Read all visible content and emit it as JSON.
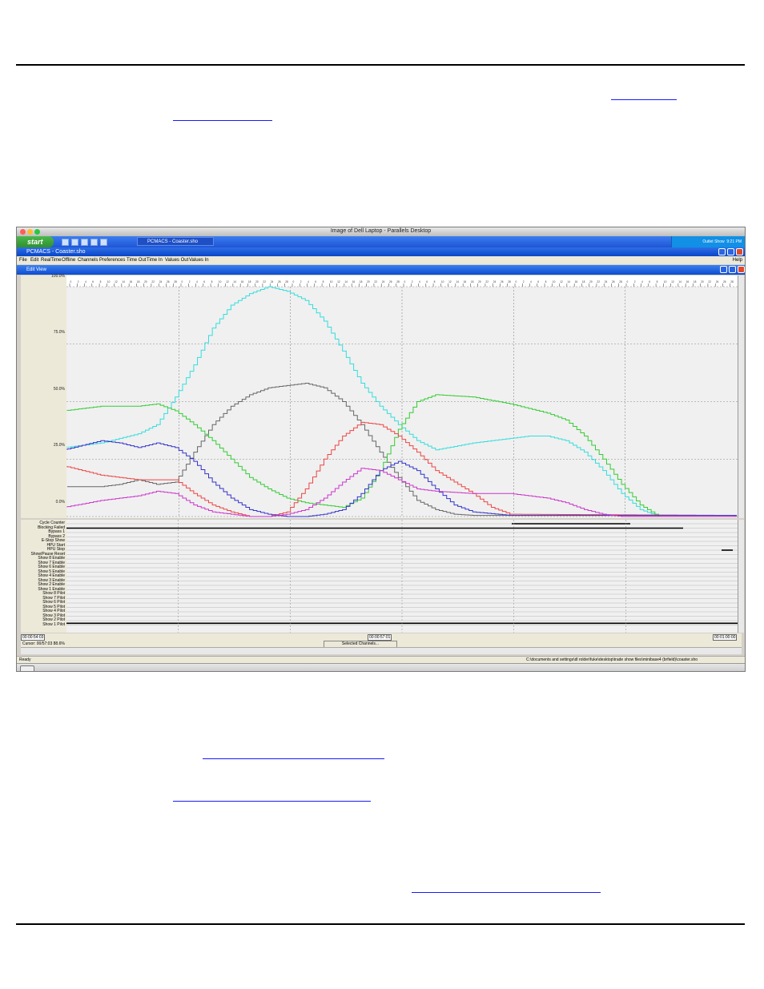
{
  "mac_window": {
    "title": "Image of Dell Laptop - Parallels Desktop"
  },
  "taskbar": {
    "start_label": "start",
    "task_button": "PCMACS - Coaster.sho",
    "tray_text": "Outlet Show",
    "clock": "9:21 PM"
  },
  "app": {
    "title": "PCMACS - Coaster.sho",
    "menu": [
      "File",
      "Edit",
      "RealTime",
      "Offline",
      "Channels",
      "Preferences",
      "Time Out",
      "Time In",
      "Values Out",
      "Values In"
    ],
    "menu_help": "Help",
    "child_window_title": "Edit View"
  },
  "chart": {
    "y_ticks": [
      "100.0%",
      "75.0%",
      "50.0%",
      "25.0%",
      "0.0%"
    ]
  },
  "chart_data": {
    "type": "line",
    "ylim": [
      0,
      100
    ],
    "y_unit": "%",
    "x_unit": "frames",
    "xlim": [
      0,
      180
    ],
    "x_ticks": [
      "0",
      "2",
      "4",
      "6",
      "8",
      "10",
      "12",
      "14",
      "16",
      "18",
      "20",
      "22",
      "24",
      "26",
      "28",
      "0",
      "2",
      "4",
      "6",
      "8",
      "10",
      "12",
      "14",
      "16",
      "18",
      "20",
      "22",
      "24",
      "26",
      "28",
      "0",
      "2",
      "4",
      "6",
      "8",
      "10",
      "12",
      "14",
      "16",
      "18",
      "20",
      "22",
      "24",
      "26",
      "28",
      "0",
      "2",
      "4",
      "6",
      "8",
      "10",
      "12",
      "14",
      "16",
      "18",
      "20",
      "22",
      "24",
      "26",
      "28",
      "0",
      "2",
      "4",
      "6",
      "8",
      "10",
      "12",
      "14",
      "16",
      "18",
      "20",
      "22",
      "24",
      "26",
      "28",
      "0",
      "2",
      "4",
      "6",
      "8",
      "10",
      "12",
      "14",
      "16",
      "18",
      "20",
      "22",
      "24",
      "26",
      "28"
    ],
    "grid": true,
    "series": [
      {
        "color": "#33dddd",
        "x": [
          0,
          10,
          20,
          25,
          30,
          35,
          40,
          45,
          50,
          55,
          60,
          65,
          70,
          75,
          80,
          85,
          90,
          95,
          100,
          110,
          120,
          125,
          130,
          135,
          140,
          145,
          150,
          155,
          160,
          180
        ],
        "y": [
          30,
          32,
          36,
          40,
          52,
          66,
          82,
          92,
          97,
          100,
          98,
          94,
          85,
          72,
          58,
          48,
          40,
          33,
          29,
          32,
          34,
          35,
          35,
          33,
          28,
          20,
          10,
          3,
          0,
          0
        ]
      },
      {
        "color": "#666666",
        "x": [
          0,
          10,
          15,
          20,
          25,
          30,
          35,
          40,
          45,
          50,
          55,
          60,
          65,
          70,
          75,
          80,
          85,
          90,
          95,
          100,
          105,
          110,
          120,
          180
        ],
        "y": [
          13,
          13,
          14,
          16,
          14,
          15,
          28,
          40,
          48,
          53,
          56,
          57,
          58,
          56,
          50,
          40,
          28,
          17,
          7,
          3,
          1,
          0.5,
          0.5,
          0.5
        ]
      },
      {
        "color": "#33cc33",
        "x": [
          0,
          10,
          20,
          25,
          30,
          35,
          40,
          45,
          50,
          55,
          60,
          65,
          70,
          75,
          80,
          85,
          90,
          95,
          100,
          110,
          120,
          125,
          130,
          135,
          140,
          145,
          150,
          155,
          160,
          180
        ],
        "y": [
          46,
          48,
          48,
          49,
          46,
          40,
          33,
          25,
          17,
          12,
          8,
          6,
          5,
          4,
          8,
          20,
          38,
          50,
          53,
          52,
          49,
          47,
          45,
          42,
          35,
          25,
          14,
          5,
          0,
          0
        ]
      },
      {
        "color": "#ee4444",
        "x": [
          0,
          10,
          20,
          25,
          30,
          35,
          40,
          45,
          50,
          55,
          60,
          65,
          70,
          75,
          80,
          85,
          90,
          95,
          100,
          110,
          115,
          120,
          180
        ],
        "y": [
          22,
          18,
          16,
          16,
          16,
          10,
          5,
          2,
          0,
          0,
          2,
          12,
          25,
          35,
          41,
          40,
          35,
          28,
          20,
          10,
          4,
          1,
          0.5
        ]
      },
      {
        "color": "#3333cc",
        "x": [
          0,
          10,
          15,
          20,
          25,
          30,
          35,
          40,
          45,
          50,
          55,
          60,
          65,
          70,
          75,
          80,
          85,
          90,
          95,
          100,
          105,
          110,
          120,
          180
        ],
        "y": [
          29,
          33,
          32,
          30,
          32,
          30,
          24,
          15,
          8,
          3,
          1,
          0,
          0,
          1,
          3,
          10,
          20,
          24,
          20,
          12,
          5,
          2,
          0.5,
          0.5
        ]
      },
      {
        "color": "#cc33cc",
        "x": [
          0,
          10,
          20,
          25,
          30,
          35,
          40,
          45,
          50,
          55,
          60,
          65,
          70,
          75,
          80,
          85,
          90,
          95,
          100,
          110,
          120,
          125,
          130,
          135,
          140,
          145,
          150,
          180
        ],
        "y": [
          4,
          7,
          9,
          11,
          10,
          5,
          2,
          1,
          0,
          0,
          1,
          3,
          8,
          15,
          21,
          20,
          16,
          12,
          11,
          10,
          10,
          9,
          8,
          6,
          3,
          1,
          0,
          0
        ]
      }
    ]
  },
  "digital": {
    "channels": [
      "Cycle Counter",
      "Blocking Failed",
      "Bypass 1",
      "Bypass 2",
      "E-Stop Show",
      "HPU Start",
      "HPU Stop",
      "Show/Pause Reset",
      "Show 8 Enable",
      "Show 7 Enable",
      "Show 6 Enable",
      "Show 5 Enable",
      "Show 4 Enable",
      "Show 3 Enable",
      "Show 2 Enable",
      "Show 1 Enable",
      "Show 8 Pilot",
      "Show 7 Pilot",
      "Show 6 Pilot",
      "Show 5 Pilot",
      "Show 4 Pilot",
      "Show 3 Pilot",
      "Show 2 Pilot",
      "Show 1 Pilot"
    ]
  },
  "bottom": {
    "left_time": "00:00:54:03",
    "cursor_label": "Cursor: 00/57:03   88.6%",
    "mid_time": "00:00:57:01",
    "right_time": "00:01:00:00",
    "selected_button": "Selected Channels..."
  },
  "status": {
    "left": "Ready",
    "path": "C:\\documents and settings\\dl rolder\\fuke\\desktop\\trade show files\\minibase4 (brfield)\\coaster.sho"
  }
}
